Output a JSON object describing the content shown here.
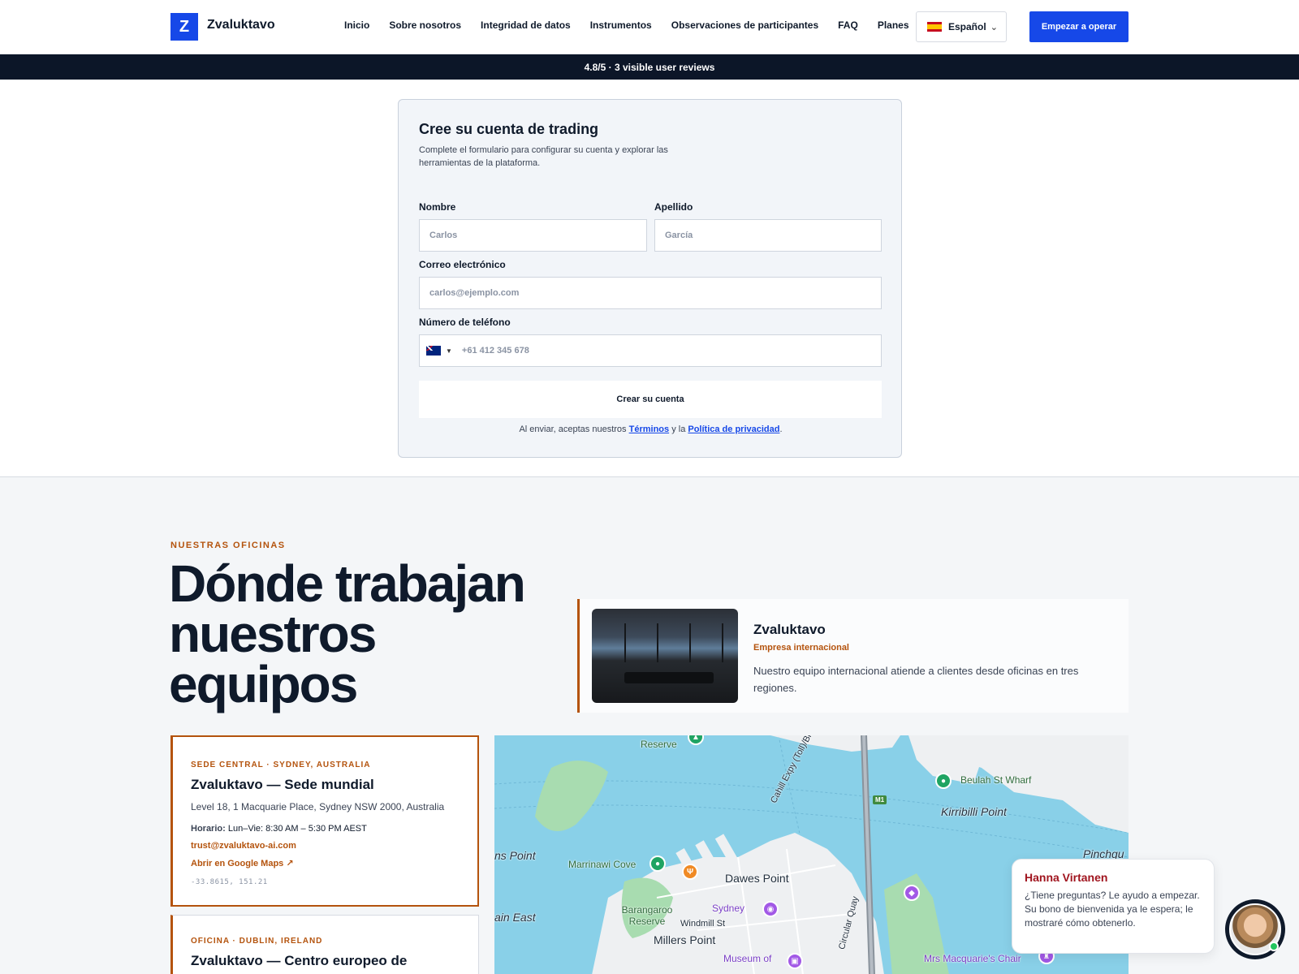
{
  "nav": {
    "logo_letter": "Z",
    "brand": "Zvaluktavo",
    "links": [
      "Inicio",
      "Sobre nosotros",
      "Integridad de datos",
      "Instrumentos",
      "Observaciones de participantes",
      "FAQ",
      "Planes"
    ],
    "language": "Español",
    "cta": "Empezar a operar"
  },
  "reviews_bar": "4.8/5 · 3 visible user reviews",
  "form": {
    "title": "Cree su cuenta de trading",
    "subtitle": "Complete el formulario para configurar su cuenta y explorar las herramientas de la plataforma.",
    "first_name_label": "Nombre",
    "first_name_placeholder": "Carlos",
    "last_name_label": "Apellido",
    "last_name_placeholder": "García",
    "email_label": "Correo electrónico",
    "email_placeholder": "carlos@ejemplo.com",
    "phone_label": "Número de teléfono",
    "phone_placeholder": "+61 412 345 678",
    "submit": "Crear su cuenta",
    "terms_prefix": "Al enviar, aceptas nuestros",
    "terms_link": "Términos",
    "terms_and": "y la",
    "privacy_link": "Política de privacidad",
    "terms_end": "."
  },
  "offices": {
    "eyebrow": "NUESTRAS OFICINAS",
    "title": "Dónde trabajan nuestros equipos",
    "intro": {
      "name": "Zvaluktavo",
      "tag": "Empresa internacional",
      "description": "Nuestro equipo internacional atiende a clientes desde oficinas en tres regiones."
    },
    "cards": [
      {
        "eyebrow": "SEDE CENTRAL · SYDNEY, AUSTRALIA",
        "title": "Zvaluktavo — Sede mundial",
        "address": "Level 18, 1 Macquarie Place, Sydney NSW 2000, Australia",
        "hours_label": "Horario:",
        "hours": "Lun–Vie: 8:30 AM – 5:30 PM AEST",
        "email": "trust@zvaluktavo-ai.com",
        "maps_link": "Abrir en Google Maps ↗",
        "coords": "-33.8615, 151.21"
      },
      {
        "eyebrow": "OFICINA · DUBLIN, IRELAND",
        "title": "Zvaluktavo — Centro europeo de"
      }
    ]
  },
  "map": {
    "labels": {
      "reserve_top": "Reserve",
      "beulah": "Beulah St Wharf",
      "kirribilli": "Kirribilli Point",
      "ns_point": "ns Point",
      "marrinawi": "Marrinawi Cove",
      "dawes": "Dawes Point",
      "pinchgut": "Pinchgu",
      "ain_east": "ain East",
      "barangaroo_reserve": "Barangaroo Reserve",
      "windmill": "Windmill St",
      "millers": "Millers Point",
      "sydney": "Sydney",
      "museum": "Museum of",
      "mrs_macquarie": "Mrs Macquarie's Chair",
      "cahill": "Cahill Expy (Toll)/Bradfield Hwy",
      "circular_quay": "Circular Quay",
      "m1": "M1"
    }
  },
  "chat": {
    "name": "Hanna Virtanen",
    "message": "¿Tiene preguntas? Le ayudo a empezar. Su bono de bienvenida ya le espera; le mostraré cómo obtenerlo."
  }
}
